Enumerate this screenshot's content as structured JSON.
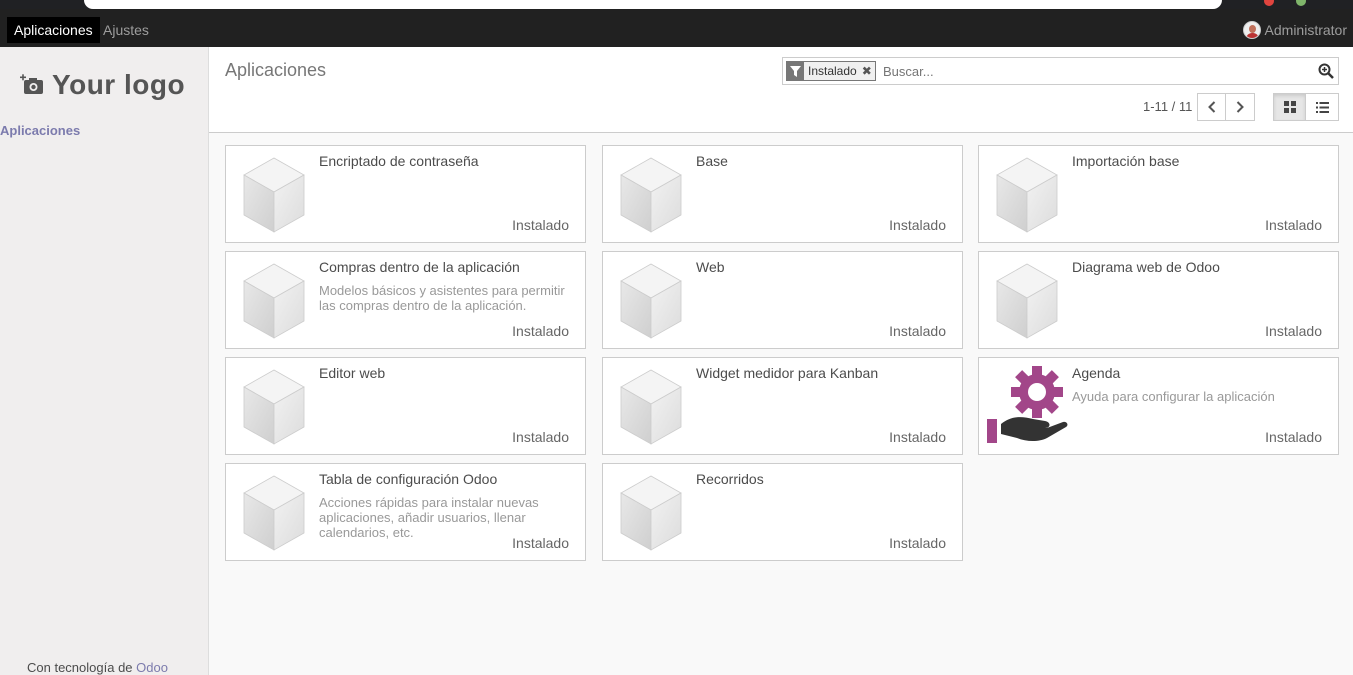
{
  "navbar": {
    "menu_items": [
      {
        "label": "Aplicaciones",
        "active": true
      },
      {
        "label": "Ajustes",
        "active": false
      }
    ],
    "user_name": "Administrator"
  },
  "sidebar": {
    "logo_text": "Your logo",
    "menu_item": "Aplicaciones",
    "powered_prefix": "Con tecnología de",
    "powered_brand": "Odoo"
  },
  "control_panel": {
    "title": "Aplicaciones",
    "facet_label": "Instalado",
    "search_placeholder": "Buscar...",
    "pager_value": "1-11 / 11"
  },
  "modules": [
    {
      "name": "Encriptado de contraseña",
      "summary": "",
      "status": "Instalado",
      "icon": "cube-icon"
    },
    {
      "name": "Base",
      "summary": "",
      "status": "Instalado",
      "icon": "cube-icon"
    },
    {
      "name": "Importación base",
      "summary": "",
      "status": "Instalado",
      "icon": "cube-icon"
    },
    {
      "name": "Compras dentro de la aplicación",
      "summary": "Modelos básicos y asistentes para permitir las compras dentro de la aplicación.",
      "status": "Instalado",
      "icon": "cube-icon"
    },
    {
      "name": "Web",
      "summary": "",
      "status": "Instalado",
      "icon": "cube-icon"
    },
    {
      "name": "Diagrama web de Odoo",
      "summary": "",
      "status": "Instalado",
      "icon": "cube-icon"
    },
    {
      "name": "Editor web",
      "summary": "",
      "status": "Instalado",
      "icon": "cube-icon"
    },
    {
      "name": "Widget medidor para Kanban",
      "summary": "",
      "status": "Instalado",
      "icon": "cube-icon"
    },
    {
      "name": "Agenda",
      "summary": "Ayuda para configurar la aplicación",
      "status": "Instalado",
      "icon": "gear-hand-icon"
    },
    {
      "name": "Tabla de configuración Odoo",
      "summary": "Acciones rápidas para instalar nuevas aplicaciones, añadir usuarios, llenar calendarios, etc.",
      "status": "Instalado",
      "icon": "cube-icon"
    },
    {
      "name": "Recorridos",
      "summary": "",
      "status": "Instalado",
      "icon": "cube-icon"
    }
  ],
  "colors": {
    "navbar": "#212121",
    "brand": "#7c7bad",
    "agenda_icon": "#a24689"
  }
}
